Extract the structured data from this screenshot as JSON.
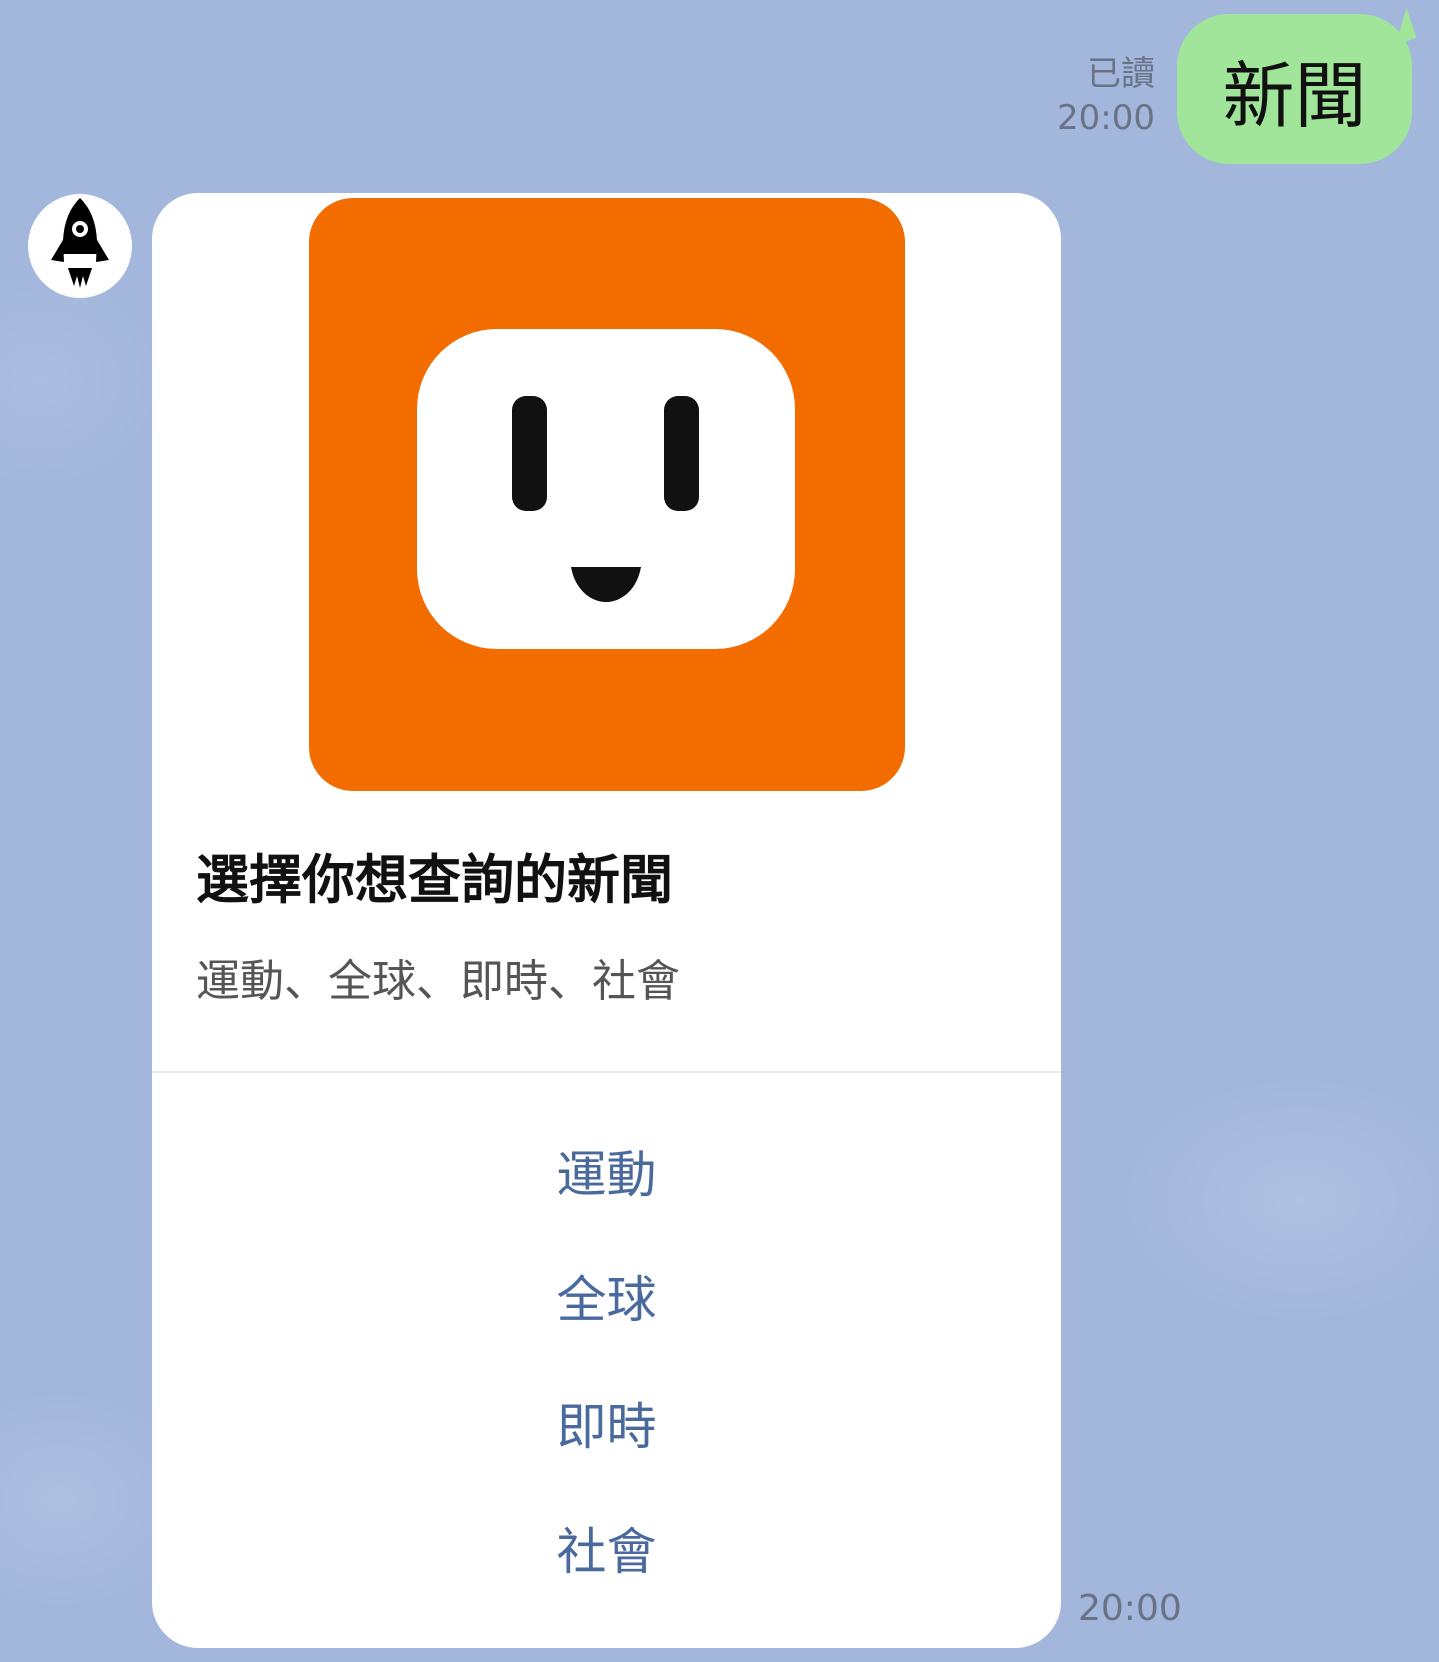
{
  "outgoing_message": {
    "text": "新聞",
    "read_status": "已讀",
    "time": "20:00",
    "bubble_color": "#a0e59a"
  },
  "incoming_card": {
    "title": "選擇你想查詢的新聞",
    "subtitle": "運動、全球、即時、社會",
    "hero_icon": "orange-outlet-face-logo",
    "options": [
      {
        "label": "運動"
      },
      {
        "label": "全球"
      },
      {
        "label": "即時"
      },
      {
        "label": "社會"
      }
    ],
    "time": "20:00",
    "option_color": "#4a6a9e"
  },
  "avatar_icon": "rocket-icon",
  "colors": {
    "chat_background": "#a3b6dc",
    "hero_orange": "#f26c00"
  }
}
